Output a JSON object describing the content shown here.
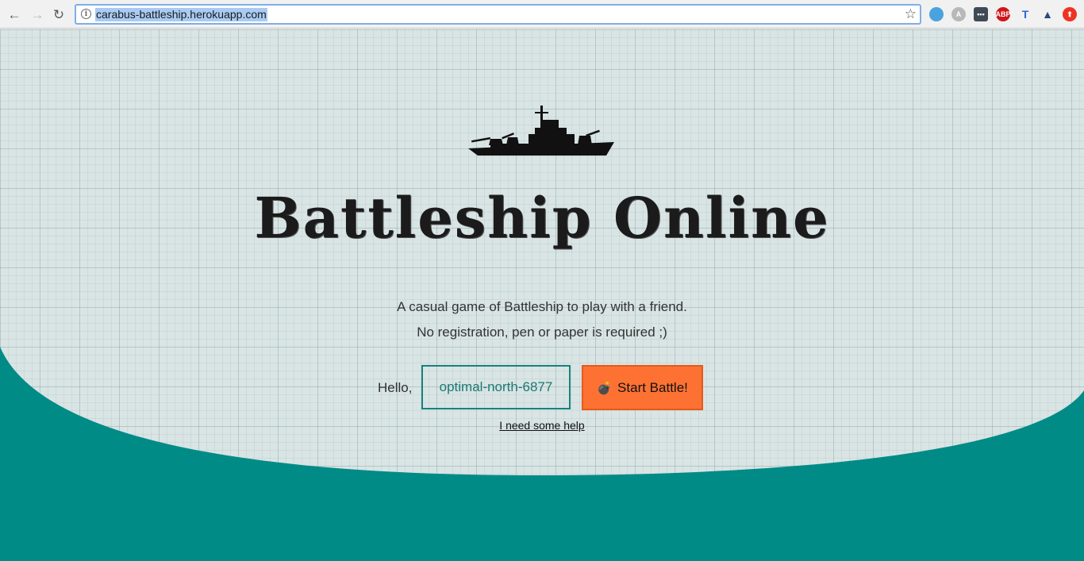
{
  "browser": {
    "url": "carabus-battleship.herokuapp.com",
    "nav": {
      "back": "←",
      "forward": "→",
      "reload": "↻"
    },
    "extensions": [
      {
        "name": "tweetdeck-icon",
        "label": "",
        "color": "#4aa3df"
      },
      {
        "name": "angular-icon",
        "label": "A",
        "color": "#b8b8b8"
      },
      {
        "name": "dots-icon",
        "label": "•••",
        "color": "#3f4a55"
      },
      {
        "name": "adblock-icon",
        "label": "ABP",
        "color": "#d0151b"
      },
      {
        "name": "typography-icon",
        "label": "T",
        "color": "#2c67d9"
      },
      {
        "name": "triangle-icon",
        "label": "▲",
        "color": "#2b4a7a"
      },
      {
        "name": "upload-icon",
        "label": "⬆",
        "color": "#e32"
      }
    ]
  },
  "page": {
    "title": "Battleship Online",
    "tagline_1": "A casual game of Battleship to play with a friend.",
    "tagline_2": "No registration, pen or paper is required ;)",
    "hello_label": "Hello,",
    "name_value": "optimal-north-6877",
    "start_button": "Start Battle!",
    "help_link": "I need some help"
  },
  "colors": {
    "teal": "#008b87",
    "accent_orange": "#fd7233",
    "grid_bg": "#d9e4e4"
  }
}
